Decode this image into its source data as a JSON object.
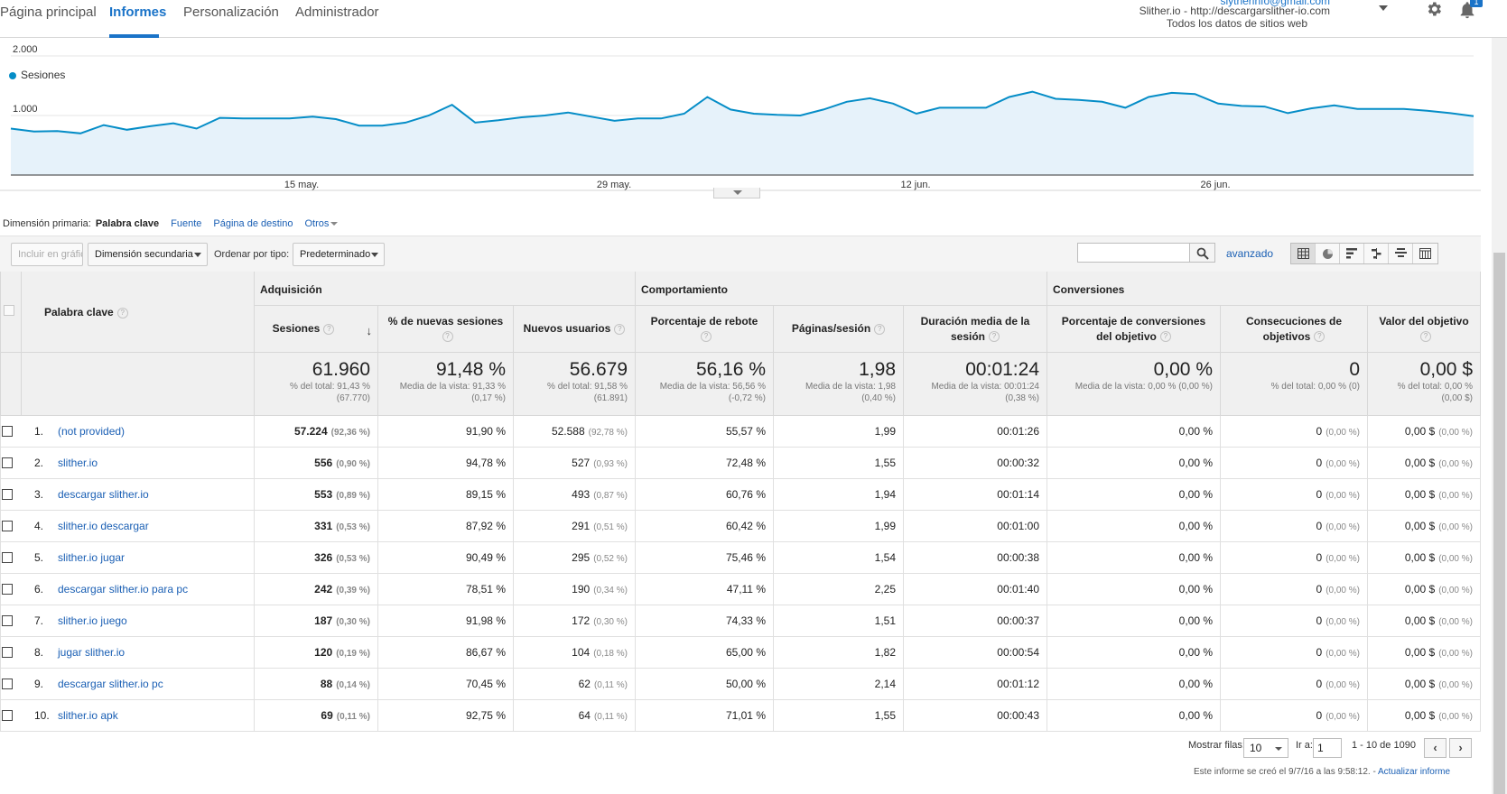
{
  "nav": {
    "tabs": [
      "Página principal",
      "Informes",
      "Personalización",
      "Administrador"
    ],
    "active": "Informes",
    "account_email": "slytherinfo@gmail.com",
    "account_line1": "Slither.io - http://descargarslither-io.com",
    "account_line2": "Todos los datos de sitios web",
    "notification_count": "1"
  },
  "chart": {
    "legend": "Sesiones",
    "y_ticks": [
      "2.000",
      "1.000"
    ],
    "x_ticks": [
      "15 may.",
      "29 may.",
      "12 jun.",
      "26 jun."
    ],
    "accent": "#058dc7"
  },
  "chart_data": {
    "type": "area",
    "title": "",
    "series": [
      {
        "name": "Sesiones",
        "values": [
          780,
          730,
          740,
          700,
          840,
          760,
          820,
          870,
          780,
          960,
          950,
          950,
          950,
          980,
          940,
          830,
          830,
          880,
          1000,
          1180,
          880,
          920,
          970,
          1000,
          1050,
          980,
          910,
          950,
          950,
          1030,
          1310,
          1100,
          1030,
          1010,
          1000,
          1100,
          1230,
          1290,
          1200,
          1030,
          1130,
          1130,
          1130,
          1310,
          1400,
          1280,
          1260,
          1230,
          1130,
          1310,
          1380,
          1360,
          1200,
          1160,
          1150,
          1040,
          1120,
          1170,
          1110,
          1110,
          1110,
          1080,
          1040,
          990
        ]
      }
    ],
    "x_ticks": [
      "15 may.",
      "29 may.",
      "12 jun.",
      "26 jun."
    ],
    "ylim": [
      0,
      2000
    ],
    "y_ticks": [
      1000,
      2000
    ]
  },
  "dimension": {
    "label": "Dimensión primaria:",
    "selected": "Palabra clave",
    "options": [
      "Fuente",
      "Página de destino",
      "Otros"
    ]
  },
  "toolbar": {
    "plot_rows": "Incluir en gráfico",
    "secondary": "Dimensión secundaria",
    "sort_label": "Ordenar por tipo:",
    "sort_value": "Predeterminado",
    "advanced": "avanzado"
  },
  "table": {
    "keyword_header": "Palabra clave",
    "groups": [
      "Adquisición",
      "Comportamiento",
      "Conversiones"
    ],
    "columns": [
      "Sesiones",
      "% de nuevas sesiones",
      "Nuevos usuarios",
      "Porcentaje de rebote",
      "Páginas/sesión",
      "Duración media de la sesión",
      "Porcentaje de conversiones del objetivo",
      "Consecuciones de objetivos",
      "Valor del objetivo"
    ],
    "totals": [
      {
        "big": "61.960",
        "s1": "% del total: 91,43 %",
        "s2": "(67.770)"
      },
      {
        "big": "91,48 %",
        "s1": "Media de la vista: 91,33 %",
        "s2": "(0,17 %)"
      },
      {
        "big": "56.679",
        "s1": "% del total: 91,58 %",
        "s2": "(61.891)"
      },
      {
        "big": "56,16 %",
        "s1": "Media de la vista: 56,56 %",
        "s2": "(-0,72 %)"
      },
      {
        "big": "1,98",
        "s1": "Media de la vista: 1,98",
        "s2": "(0,40 %)"
      },
      {
        "big": "00:01:24",
        "s1": "Media de la vista: 00:01:24",
        "s2": "(0,38 %)"
      },
      {
        "big": "0,00 %",
        "s1": "Media de la vista: 0,00 % (0,00 %)",
        "s2": ""
      },
      {
        "big": "0",
        "s1": "% del total: 0,00 % (0)",
        "s2": ""
      },
      {
        "big": "0,00 $",
        "s1": "% del total: 0,00 %",
        "s2": "(0,00 $)"
      }
    ],
    "rows": [
      {
        "n": "1.",
        "kw": "(not provided)",
        "ses": "57.224",
        "sesp": "(92,36 %)",
        "nps": "91,90 %",
        "nu": "52.588",
        "nup": "(92,78 %)",
        "reb": "55,57 %",
        "pps": "1,99",
        "dur": "00:01:26",
        "conv": "0,00 %",
        "goal": "0",
        "goalp": "(0,00 %)",
        "val": "0,00 $",
        "valp": "(0,00 %)"
      },
      {
        "n": "2.",
        "kw": "slither.io",
        "ses": "556",
        "sesp": "(0,90 %)",
        "nps": "94,78 %",
        "nu": "527",
        "nup": "(0,93 %)",
        "reb": "72,48 %",
        "pps": "1,55",
        "dur": "00:00:32",
        "conv": "0,00 %",
        "goal": "0",
        "goalp": "(0,00 %)",
        "val": "0,00 $",
        "valp": "(0,00 %)"
      },
      {
        "n": "3.",
        "kw": "descargar slither.io",
        "ses": "553",
        "sesp": "(0,89 %)",
        "nps": "89,15 %",
        "nu": "493",
        "nup": "(0,87 %)",
        "reb": "60,76 %",
        "pps": "1,94",
        "dur": "00:01:14",
        "conv": "0,00 %",
        "goal": "0",
        "goalp": "(0,00 %)",
        "val": "0,00 $",
        "valp": "(0,00 %)"
      },
      {
        "n": "4.",
        "kw": "slither.io descargar",
        "ses": "331",
        "sesp": "(0,53 %)",
        "nps": "87,92 %",
        "nu": "291",
        "nup": "(0,51 %)",
        "reb": "60,42 %",
        "pps": "1,99",
        "dur": "00:01:00",
        "conv": "0,00 %",
        "goal": "0",
        "goalp": "(0,00 %)",
        "val": "0,00 $",
        "valp": "(0,00 %)"
      },
      {
        "n": "5.",
        "kw": "slither.io jugar",
        "ses": "326",
        "sesp": "(0,53 %)",
        "nps": "90,49 %",
        "nu": "295",
        "nup": "(0,52 %)",
        "reb": "75,46 %",
        "pps": "1,54",
        "dur": "00:00:38",
        "conv": "0,00 %",
        "goal": "0",
        "goalp": "(0,00 %)",
        "val": "0,00 $",
        "valp": "(0,00 %)"
      },
      {
        "n": "6.",
        "kw": "descargar slither.io para pc",
        "ses": "242",
        "sesp": "(0,39 %)",
        "nps": "78,51 %",
        "nu": "190",
        "nup": "(0,34 %)",
        "reb": "47,11 %",
        "pps": "2,25",
        "dur": "00:01:40",
        "conv": "0,00 %",
        "goal": "0",
        "goalp": "(0,00 %)",
        "val": "0,00 $",
        "valp": "(0,00 %)"
      },
      {
        "n": "7.",
        "kw": "slither.io juego",
        "ses": "187",
        "sesp": "(0,30 %)",
        "nps": "91,98 %",
        "nu": "172",
        "nup": "(0,30 %)",
        "reb": "74,33 %",
        "pps": "1,51",
        "dur": "00:00:37",
        "conv": "0,00 %",
        "goal": "0",
        "goalp": "(0,00 %)",
        "val": "0,00 $",
        "valp": "(0,00 %)"
      },
      {
        "n": "8.",
        "kw": "jugar slither.io",
        "ses": "120",
        "sesp": "(0,19 %)",
        "nps": "86,67 %",
        "nu": "104",
        "nup": "(0,18 %)",
        "reb": "65,00 %",
        "pps": "1,82",
        "dur": "00:00:54",
        "conv": "0,00 %",
        "goal": "0",
        "goalp": "(0,00 %)",
        "val": "0,00 $",
        "valp": "(0,00 %)"
      },
      {
        "n": "9.",
        "kw": "descargar slither.io pc",
        "ses": "88",
        "sesp": "(0,14 %)",
        "nps": "70,45 %",
        "nu": "62",
        "nup": "(0,11 %)",
        "reb": "50,00 %",
        "pps": "2,14",
        "dur": "00:01:12",
        "conv": "0,00 %",
        "goal": "0",
        "goalp": "(0,00 %)",
        "val": "0,00 $",
        "valp": "(0,00 %)"
      },
      {
        "n": "10.",
        "kw": "slither.io apk",
        "ses": "69",
        "sesp": "(0,11 %)",
        "nps": "92,75 %",
        "nu": "64",
        "nup": "(0,11 %)",
        "reb": "71,01 %",
        "pps": "1,55",
        "dur": "00:00:43",
        "conv": "0,00 %",
        "goal": "0",
        "goalp": "(0,00 %)",
        "val": "0,00 $",
        "valp": "(0,00 %)"
      }
    ]
  },
  "pager": {
    "rows_label": "Mostrar filas:",
    "rows_value": "10",
    "goto_label": "Ir a:",
    "goto_value": "1",
    "range": "1 - 10 de 1090",
    "prev": "‹",
    "next": "›"
  },
  "footer": {
    "created": "Este informe se creó el 9/7/16 a las 9:58:12. -",
    "refresh": "Actualizar informe"
  }
}
